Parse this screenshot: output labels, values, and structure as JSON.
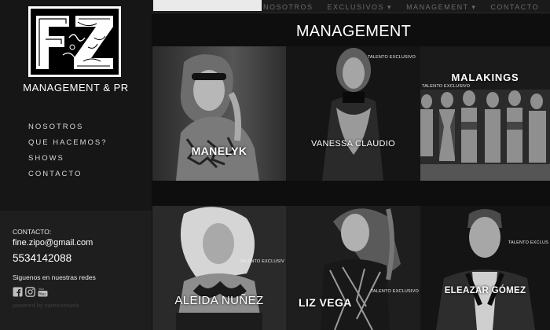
{
  "sidebar": {
    "brand": "MANAGEMENT & PR",
    "nav": [
      "NOSOTROS",
      "QUE HACEMOS?",
      "SHOWS",
      "CONTACTO"
    ]
  },
  "contact": {
    "label": "CONTACTO:",
    "email": "fine.zipo@gmail.com",
    "phone": "5534142088",
    "follow": "Siguenos en nuestras redes",
    "powered": "powered by zarescietweb"
  },
  "top_nav": [
    "NOSOTROS",
    "EXCLUSIVOS ▾",
    "MANAGEMENT ▾",
    "CONTACTO"
  ],
  "page_title": "MANAGEMENT",
  "artists": [
    {
      "name": "MANELYK",
      "tag": ""
    },
    {
      "name": "VANESSA CLAUDIO",
      "tag": "TALENTO EXCLUSIVO"
    },
    {
      "name": "MALAKINGS",
      "tag": "TALENTO EXCLUSIVO"
    },
    {
      "name": "ALEIDA NUÑEZ",
      "tag": "TALENTO EXCLUSIV"
    },
    {
      "name": "LIZ VEGA",
      "tag": "TALENTO EXCLUSIVO"
    },
    {
      "name": "ELEAZAR GÓMEZ",
      "tag": "TALENTO EXCLUS"
    }
  ],
  "icons": [
    "facebook-icon",
    "instagram-icon",
    "youtube-icon"
  ]
}
